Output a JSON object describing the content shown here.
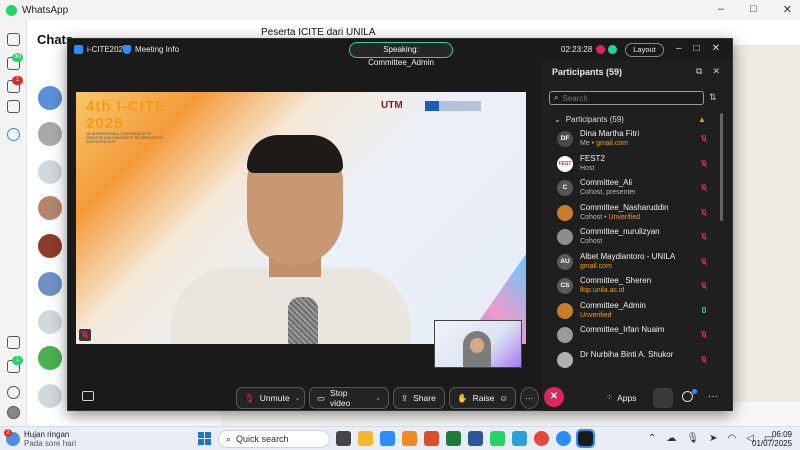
{
  "whatsapp": {
    "app_title": "WhatsApp",
    "chats_title": "Chats",
    "chat_header": "Peserta ICITE dari UNILA",
    "rail_badges": [
      "30",
      "1",
      "1"
    ]
  },
  "zoom": {
    "app_name": "i-CITE2025",
    "meeting_info": "Meeting Info",
    "speaking": "Speaking: Committee_Admin",
    "timer": "02:23:28",
    "layout_label": "Layout",
    "video_banner": {
      "title": "4th I-CITE 2025",
      "subtitle": "4th INTERNATIONAL CONFERENCE ON CREATIVE AND INNOVATIVE TECHNOLOGY IN EDUCATION 2025",
      "utm": "UTM"
    },
    "participants_panel": {
      "title": "Participants (59)",
      "search_placeholder": "Search",
      "group_label": "Participants (59)",
      "participants": [
        {
          "initials": "DF",
          "name": "Dina Martha Fitri",
          "sub_prefix": "Me • ",
          "sub_accent": "gmail.com",
          "avatar_color": "#4a4a4a",
          "mic_color": "#e0245e"
        },
        {
          "initials": "FEST",
          "name": "FEST2",
          "sub_prefix": "Host",
          "sub_accent": "",
          "avatar_color": "#ffffff",
          "mic_color": "#e0245e"
        },
        {
          "initials": "C",
          "name": "Committee_Ali",
          "sub_prefix": "Cohost, presenter",
          "sub_accent": "",
          "avatar_color": "#555555",
          "mic_color": "#e0245e"
        },
        {
          "initials": "",
          "name": "Committee_Nasharuddin",
          "sub_prefix": "Cohost • ",
          "sub_accent": "Unverified",
          "avatar_color": "#c77d2a",
          "mic_color": "#e0245e"
        },
        {
          "initials": "",
          "name": "Committee_nurulizyan",
          "sub_prefix": "Cohost",
          "sub_accent": "",
          "avatar_color": "#8d8d8d",
          "mic_color": "#e0245e"
        },
        {
          "initials": "AU",
          "name": "Albet Maydiantoro - UNILA",
          "sub_prefix": "",
          "sub_accent": "gmail.com",
          "avatar_color": "#5a5a5a",
          "mic_color": "#e0245e"
        },
        {
          "initials": "CS",
          "name": "Committee_ Sheren",
          "sub_prefix": "",
          "sub_accent": "fkip.unila.ac.id",
          "avatar_color": "#5a5a5a",
          "mic_color": "#e0245e"
        },
        {
          "initials": "",
          "name": "Committee_Admin",
          "sub_prefix": "",
          "sub_accent": "Unverified",
          "avatar_color": "#c77d2a",
          "mic_color": "#2ad29a"
        },
        {
          "initials": "",
          "name": "Committee_Irfan Nuaim",
          "sub_prefix": "",
          "sub_accent": "",
          "avatar_color": "#9a9a9a",
          "mic_color": "#e0245e"
        },
        {
          "initials": "",
          "name": "Dr Nurbiha Binti A. Shukor",
          "sub_prefix": "",
          "sub_accent": "",
          "avatar_color": "#b0b0b0",
          "mic_color": "#e0245e"
        }
      ]
    },
    "toolbar": {
      "unmute": "Unmute",
      "stop_video": "Stop video",
      "share": "Share",
      "raise": "Raise",
      "apps": "Apps"
    }
  },
  "taskbar": {
    "weather_title": "Hujan ringan",
    "weather_sub": "Pada sore hari",
    "weather_badge": "2",
    "search_placeholder": "Quick search",
    "time": "06:09",
    "date": "01/07/2025"
  },
  "colors": {
    "accent": "#2d8cff",
    "speaking_border": "#2ad29a",
    "end_call": "#e0245e",
    "unverified": "#f59e0b"
  }
}
